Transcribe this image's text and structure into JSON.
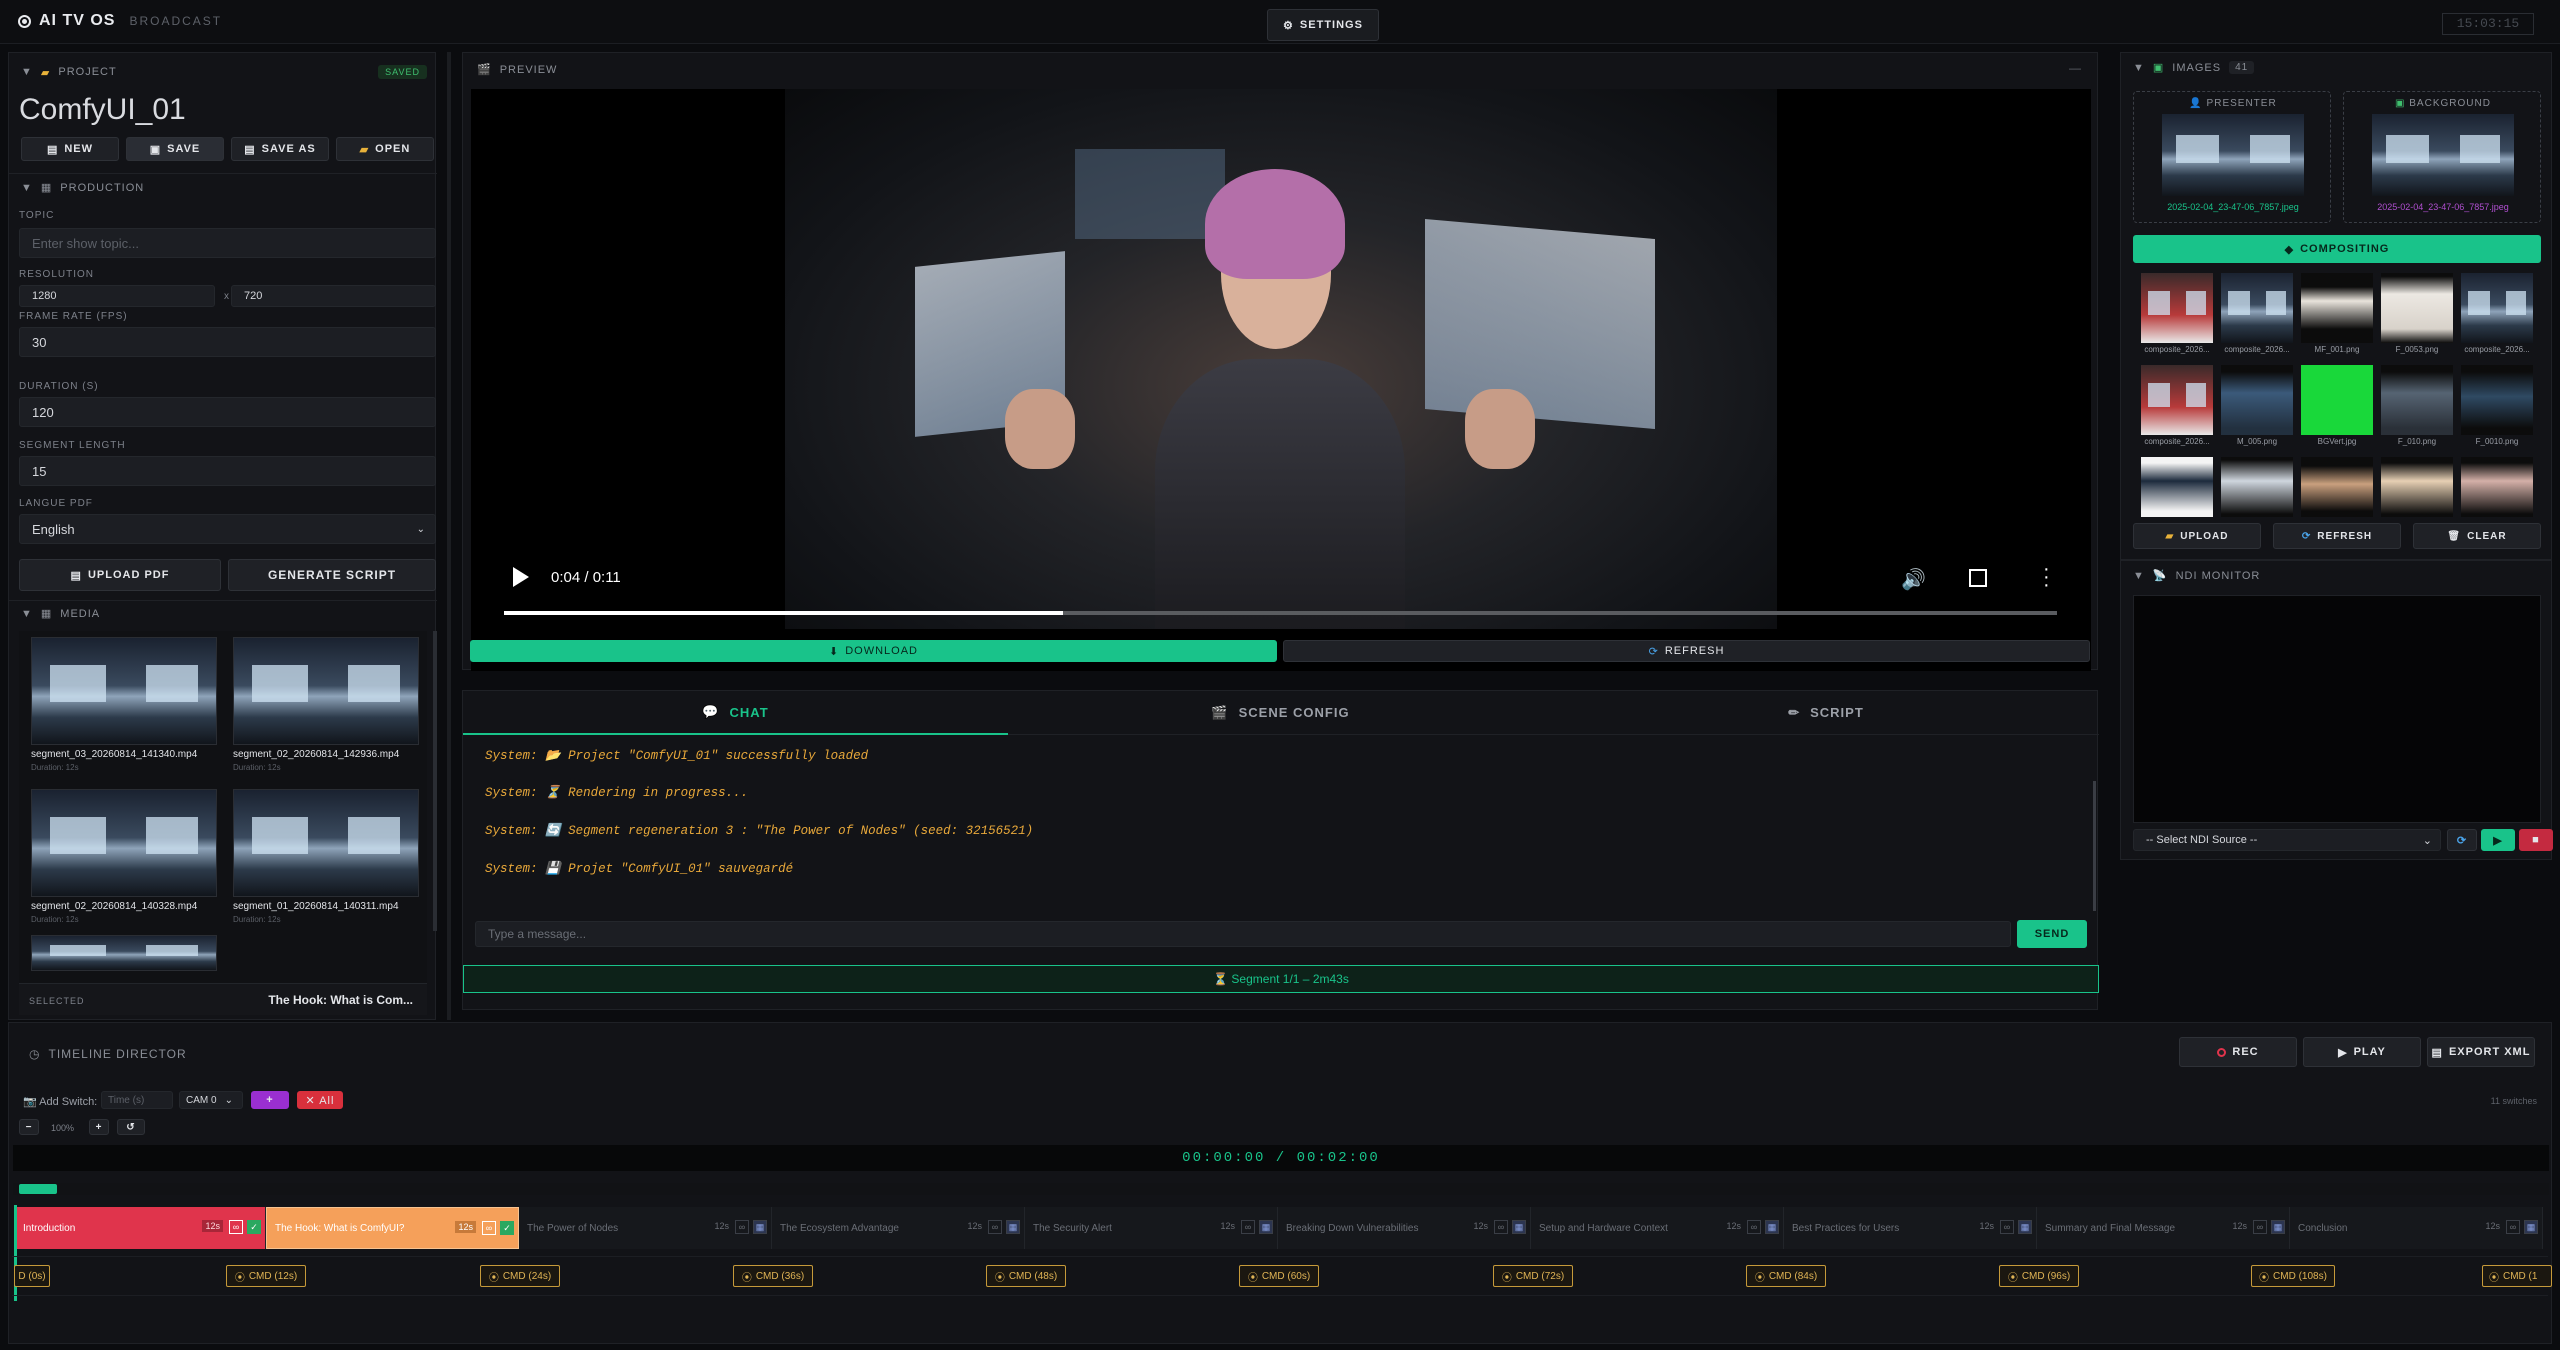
{
  "app": {
    "name": "AI TV OS",
    "subtitle": "BROADCAST",
    "clock": "15:03:15",
    "settings_label": "SETTINGS"
  },
  "project": {
    "section": "PROJECT",
    "badge": "SAVED",
    "name": "ComfyUI_01",
    "buttons": [
      "NEW",
      "SAVE",
      "SAVE AS",
      "OPEN"
    ]
  },
  "production": {
    "section": "PRODUCTION",
    "topic_label": "TOPIC",
    "topic_placeholder": "Enter show topic...",
    "resolution_label": "RESOLUTION",
    "res_w": "1280",
    "res_x": "x",
    "res_h": "720",
    "fps_label": "FRAME RATE (FPS)",
    "fps": "30",
    "duration_label": "DURATION (S)",
    "duration": "120",
    "seglen_label": "SEGMENT LENGTH",
    "seglen": "15",
    "lang_label": "LANGUE PDF",
    "lang": "English",
    "upload_pdf": "UPLOAD PDF",
    "generate_script": "GENERATE SCRIPT"
  },
  "media": {
    "section": "MEDIA",
    "items": [
      {
        "name": "segment_03_20260814_141340.mp4",
        "dur": "Duration: 12s"
      },
      {
        "name": "segment_02_20260814_142936.mp4",
        "dur": "Duration: 12s"
      },
      {
        "name": "segment_02_20260814_140328.mp4",
        "dur": "Duration: 12s"
      },
      {
        "name": "segment_01_20260814_140311.mp4",
        "dur": "Duration: 12s"
      }
    ],
    "selected_label": "SELECTED",
    "selected_value": "The Hook: What is Com..."
  },
  "preview": {
    "section": "PREVIEW",
    "time": "0:04 / 0:11",
    "progress": 0.36,
    "download": "DOWNLOAD",
    "refresh": "REFRESH"
  },
  "tabs": [
    "CHAT",
    "SCENE CONFIG",
    "SCRIPT"
  ],
  "chat": {
    "messages": [
      "System: 📂 Project \"ComfyUI_01\" successfully loaded",
      "System: ⏳ Rendering in progress...",
      "System: 🔄 Segment regeneration 3 : \"The Power of Nodes\" (seed: 32156521)",
      "System: 💾 Projet \"ComfyUI_01\" sauvegardé"
    ],
    "placeholder": "Type a message...",
    "send": "SEND",
    "status": "⏳ Segment 1/1 – 2m43s"
  },
  "images": {
    "section": "IMAGES",
    "count": "41",
    "presenter_label": "PRESENTER",
    "presenter_file": "2025-02-04_23-47-06_7857.jpeg",
    "background_label": "BACKGROUND",
    "background_file": "2025-02-04_23-47-06_7857.jpeg",
    "compositing": "COMPOSITING",
    "grid": [
      "composite_2026...",
      "composite_2026...",
      "MF_001.png",
      "F_0053.png",
      "composite_2026...",
      "composite_2026...",
      "M_005.png",
      "BGVert.jpg",
      "F_010.png",
      "F_0010.png",
      "",
      "",
      "",
      "",
      ""
    ],
    "upload": "UPLOAD",
    "refresh": "REFRESH",
    "clear": "CLEAR"
  },
  "ndi": {
    "section": "NDI MONITOR",
    "select": "-- Select NDI Source --"
  },
  "timeline": {
    "section": "TIMELINE DIRECTOR",
    "rec": "REC",
    "play": "PLAY",
    "export": "EXPORT XML",
    "add_switch": "Add Switch:",
    "time_placeholder": "Time (s)",
    "cam": "CAM 0",
    "add": "+",
    "clear_all": "✕ All",
    "switches": "11 switches",
    "zoom": "100%",
    "minus": "−",
    "plus": "+",
    "reset": "↺",
    "timecode": "00:00:00 / 00:02:00",
    "segments": [
      {
        "title": "Introduction",
        "dur": "12s"
      },
      {
        "title": "The Hook: What is ComfyUI?",
        "dur": "12s"
      },
      {
        "title": "The Power of Nodes",
        "dur": "12s"
      },
      {
        "title": "The Ecosystem Advantage",
        "dur": "12s"
      },
      {
        "title": "The Security Alert",
        "dur": "12s"
      },
      {
        "title": "Breaking Down Vulnerabilities",
        "dur": "12s"
      },
      {
        "title": "Setup and Hardware Context",
        "dur": "12s"
      },
      {
        "title": "Best Practices for Users",
        "dur": "12s"
      },
      {
        "title": "Summary and Final Message",
        "dur": "12s"
      },
      {
        "title": "Conclusion",
        "dur": "12s"
      }
    ],
    "cmds": [
      "D (0s)",
      "CMD (12s)",
      "CMD (24s)",
      "CMD (36s)",
      "CMD (48s)",
      "CMD (60s)",
      "CMD (72s)",
      "CMD (84s)",
      "CMD (96s)",
      "CMD (108s)",
      "CMD (1"
    ]
  },
  "colors": {
    "accent": "#19c38a",
    "seg1": "#e0344c",
    "seg2": "#f5a05a",
    "rec": "#e0344c"
  }
}
